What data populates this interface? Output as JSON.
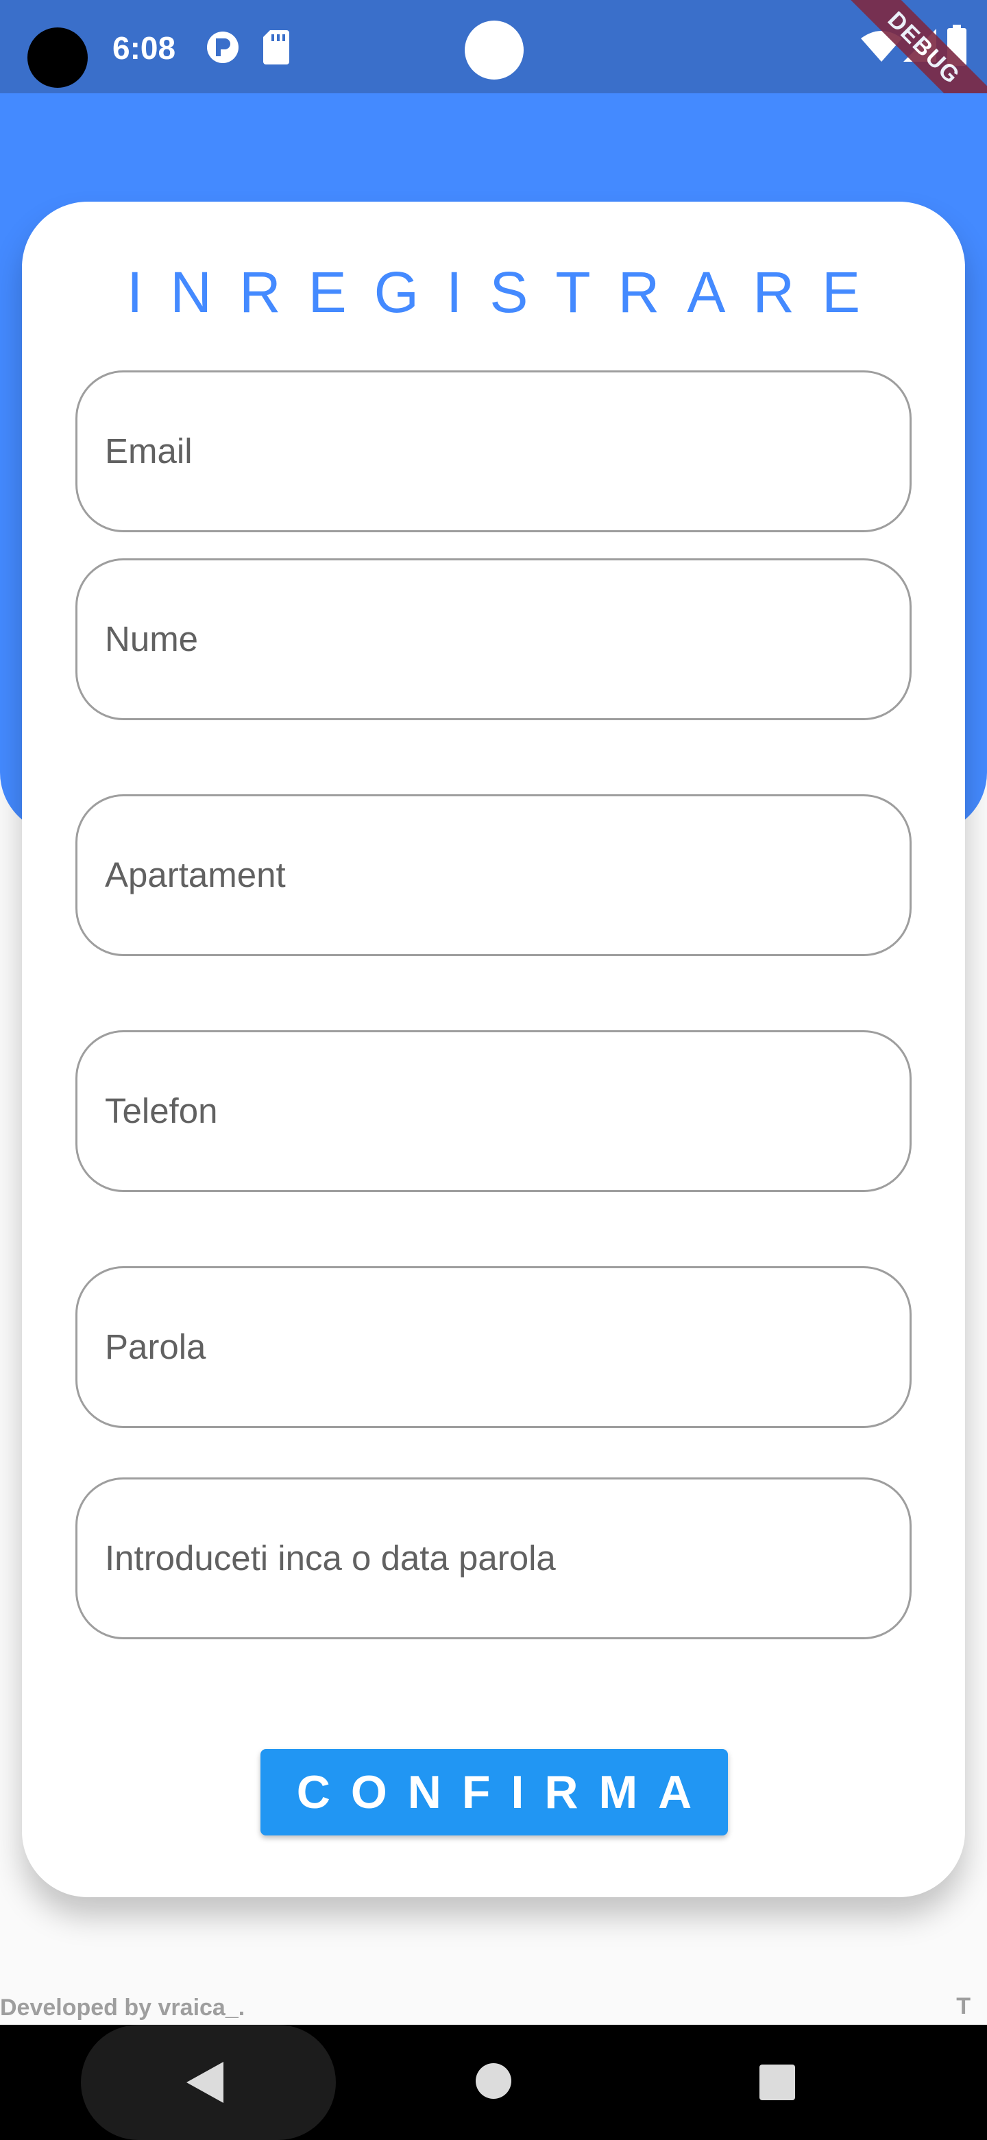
{
  "status_bar": {
    "time": "6:08",
    "icons": [
      "notification-p-icon",
      "sd-card-icon",
      "wifi-icon",
      "signal-icon",
      "battery-icon"
    ],
    "debug_label": "DEBUG"
  },
  "form": {
    "title": "INREGISTRARE",
    "fields": [
      {
        "name": "email",
        "label": "Email"
      },
      {
        "name": "nume",
        "label": "Nume"
      },
      {
        "name": "apartament",
        "label": "Apartament"
      },
      {
        "name": "telefon",
        "label": "Telefon"
      },
      {
        "name": "parola",
        "label": "Parola"
      },
      {
        "name": "confirm-parola",
        "label": "Introduceti inca o data parola"
      }
    ],
    "confirm_label": "CONFIRMA"
  },
  "footer": {
    "credit": "Developed by vraica_.",
    "right_text": "T"
  },
  "nav_bar": {
    "icons": [
      "back-icon",
      "home-icon",
      "recents-icon"
    ]
  },
  "colors": {
    "primary": "#448aff",
    "button": "#2196f3",
    "status_bar": "#3a6fca",
    "field_border": "#9e9e9e"
  }
}
